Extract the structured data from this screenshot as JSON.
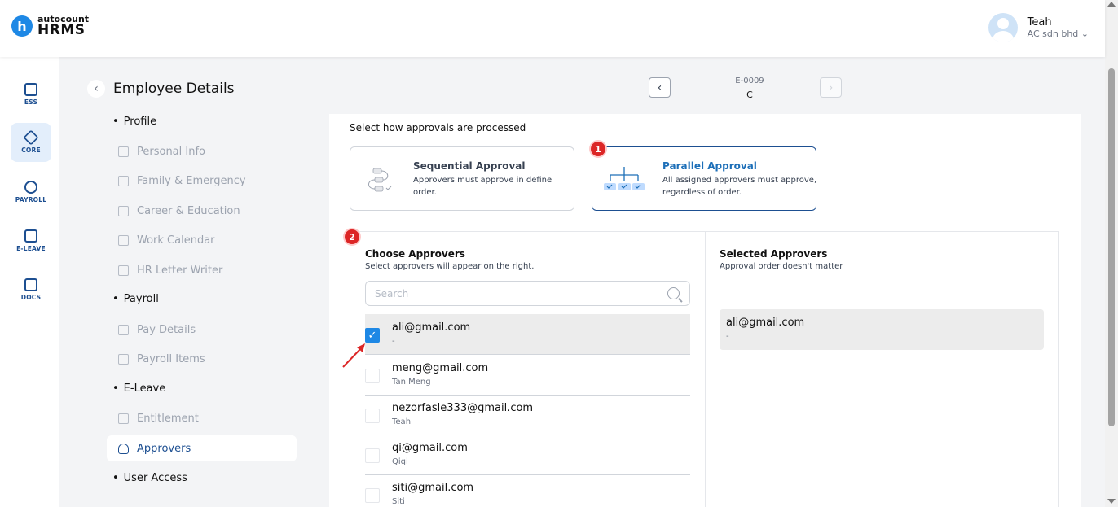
{
  "header": {
    "logo_small": "autocount",
    "logo_large": "HRMS",
    "logo_letter": "h",
    "user_name": "Teah",
    "company": "AC sdn bhd ⌄"
  },
  "rail": [
    {
      "label": "ESS",
      "icon": "user-card-icon"
    },
    {
      "label": "CORE",
      "icon": "cube-icon"
    },
    {
      "label": "PAYROLL",
      "icon": "dollar-icon"
    },
    {
      "label": "E-LEAVE",
      "icon": "calendar-icon"
    },
    {
      "label": "DOCS",
      "icon": "document-icon"
    }
  ],
  "page": {
    "title": "Employee Details",
    "employee_code": "E-0009",
    "employee_name": "C"
  },
  "menu": {
    "profile": "Profile",
    "personal_info": "Personal Info",
    "family": "Family & Emergency",
    "career": "Career & Education",
    "work_calendar": "Work Calendar",
    "hr_letter": "HR Letter Writer",
    "payroll": "Payroll",
    "pay_details": "Pay Details",
    "payroll_items": "Payroll Items",
    "eleave": "E-Leave",
    "entitlement": "Entitlement",
    "approvers": "Approvers",
    "user_access": "User Access"
  },
  "approval": {
    "prompt": "Select how approvals are processed",
    "sequential_title": "Sequential Approval",
    "sequential_desc": "Approvers must approve in define order.",
    "parallel_title": "Parallel Approval",
    "parallel_desc": "All assigned approvers must approve, regardless of order.",
    "badge1": "1",
    "badge2": "2"
  },
  "choose": {
    "title": "Choose Approvers",
    "subtitle": "Select approvers will appear on the right.",
    "search_placeholder": "Search",
    "rows": [
      {
        "email": "ali@gmail.com",
        "name": "-",
        "checked": true
      },
      {
        "email": "meng@gmail.com",
        "name": "Tan Meng",
        "checked": false
      },
      {
        "email": "nezorfasle333@gmail.com",
        "name": "Teah",
        "checked": false
      },
      {
        "email": "qi@gmail.com",
        "name": "Qiqi",
        "checked": false
      },
      {
        "email": "siti@gmail.com",
        "name": "Siti",
        "checked": false
      }
    ]
  },
  "selected": {
    "title": "Selected Approvers",
    "subtitle": "Approval order doesn't matter",
    "items": [
      {
        "email": "ali@gmail.com",
        "name": "-"
      }
    ]
  },
  "colors": {
    "primary": "#1d4f91",
    "accent": "#1e88e5",
    "badge": "#dc2626"
  }
}
